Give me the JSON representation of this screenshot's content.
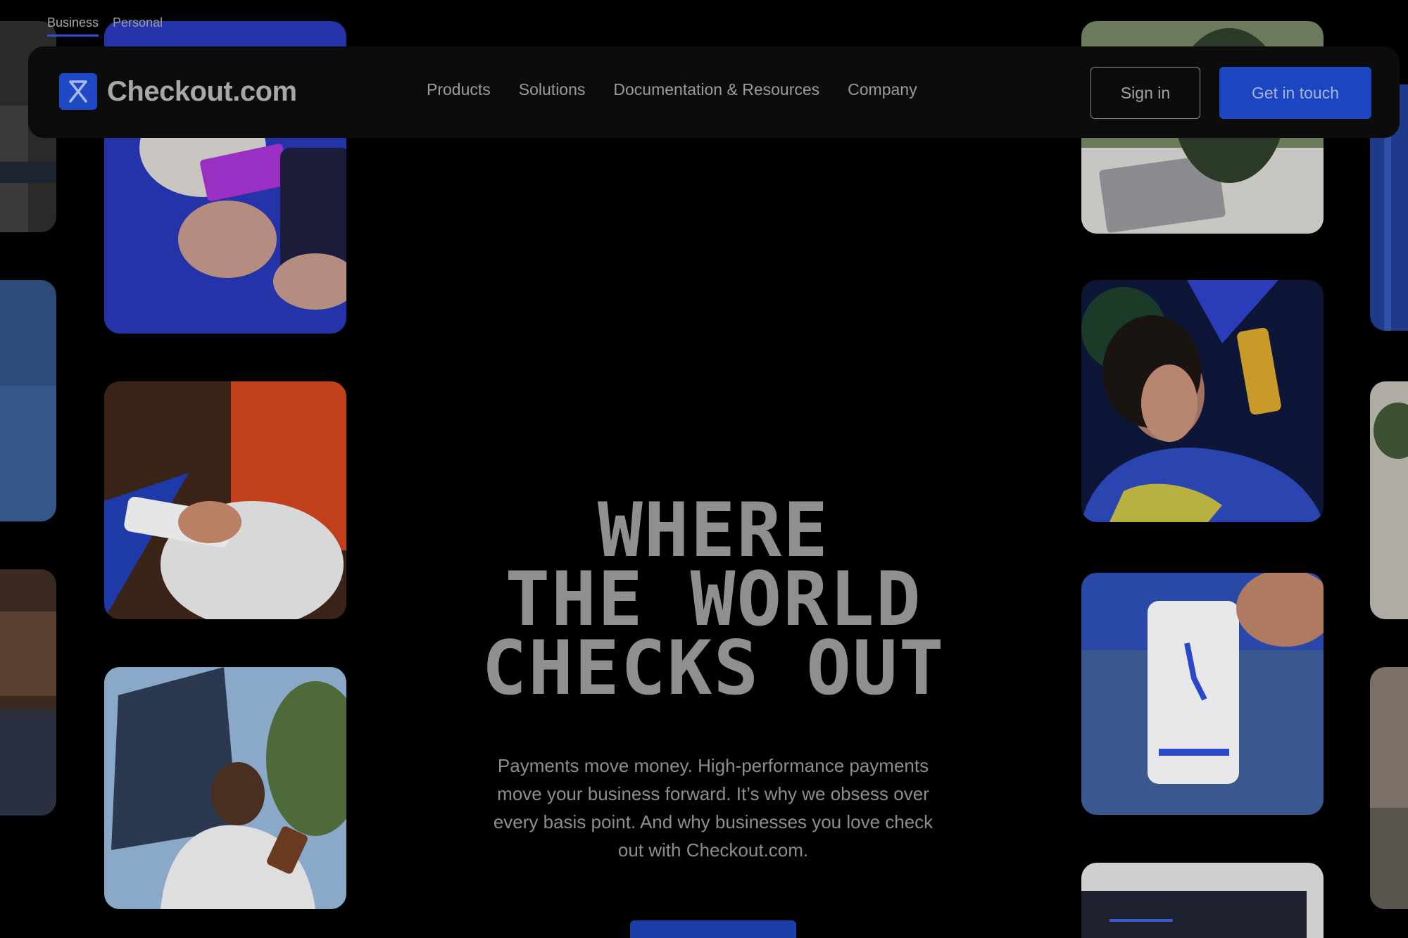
{
  "segments": [
    {
      "label": "Business",
      "active": true
    },
    {
      "label": "Personal",
      "active": false
    }
  ],
  "brand": {
    "name": "Checkout.com",
    "accent": "#1f49c4"
  },
  "nav": {
    "links": [
      "Products",
      "Solutions",
      "Documentation & Resources",
      "Company"
    ],
    "sign_in": "Sign in",
    "get_in_touch": "Get in touch"
  },
  "hero": {
    "title_lines": [
      "WHERE",
      "THE WORLD",
      "CHECKS OUT"
    ],
    "subtitle": "Payments move money. High-performance payments move your business forward. It’s why we obsess over every basis point. And why businesses you love check out with Checkout.com."
  }
}
